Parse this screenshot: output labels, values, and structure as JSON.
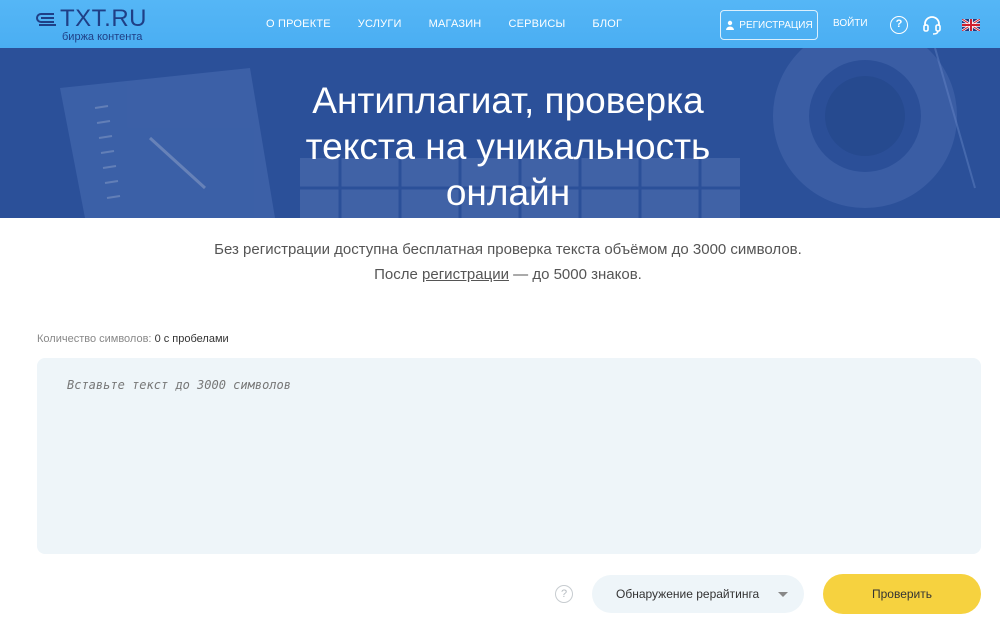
{
  "header": {
    "logo_text": "TXT.RU",
    "logo_sub": "биржа контента",
    "nav": [
      "О ПРОЕКТЕ",
      "УСЛУГИ",
      "МАГАЗИН",
      "СЕРВИСЫ",
      "БЛОГ"
    ],
    "register_label": "РЕГИСТРАЦИЯ",
    "login_label": "ВОЙТИ",
    "help_glyph": "?"
  },
  "hero": {
    "title_line1": "Антиплагиат, проверка",
    "title_line2": "текста на уникальность",
    "title_line3": "онлайн"
  },
  "intro": {
    "line1": "Без регистрации доступна бесплатная проверка текста объёмом до 3000 символов.",
    "line2_before": "После ",
    "line2_link": "регистрации",
    "line2_after": " — до 5000 знаков."
  },
  "counter": {
    "label": "Количество символов:",
    "value": "0 с пробелами"
  },
  "editor": {
    "placeholder": "Вставьте текст до 3000 символов",
    "value": ""
  },
  "controls": {
    "help_glyph": "?",
    "mode_select": "Обнаружение рерайтинга",
    "submit_label": "Проверить"
  },
  "colors": {
    "header": "#4fb2f5",
    "hero": "#2a4f98",
    "submit": "#f6d23f",
    "field": "#eef5f9"
  }
}
